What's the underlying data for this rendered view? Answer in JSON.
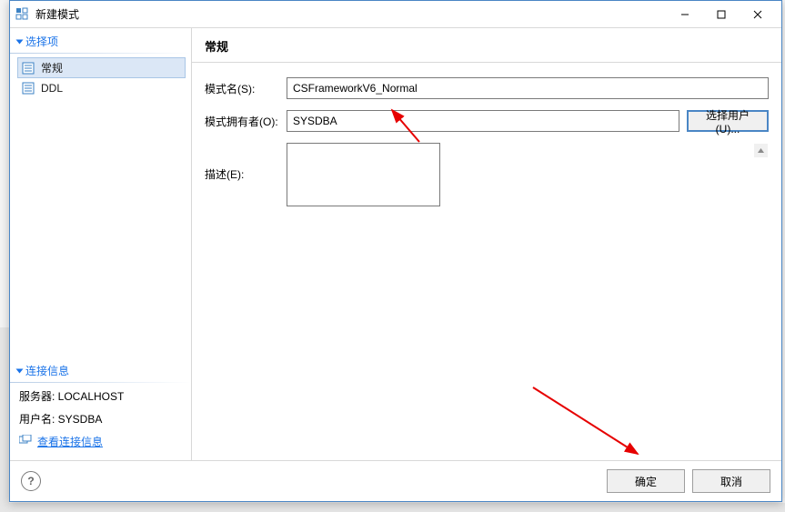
{
  "window": {
    "title": "新建模式"
  },
  "sidebar": {
    "section_options_title": "选择项",
    "items": [
      {
        "label": "常规"
      },
      {
        "label": "DDL"
      }
    ],
    "section_connection_title": "连接信息",
    "server_line": "服务器: LOCALHOST",
    "user_line": "用户名: SYSDBA",
    "view_link": "查看连接信息"
  },
  "content": {
    "header": "常规",
    "schema_name_label": "模式名(S):",
    "schema_name_value": "CSFrameworkV6_Normal",
    "owner_label": "模式拥有者(O):",
    "owner_value": "SYSDBA",
    "choose_user_button": "选择用户(U)...",
    "description_label": "描述(E):",
    "description_value": ""
  },
  "footer": {
    "help_label": "?",
    "ok_label": "确定",
    "cancel_label": "取消"
  }
}
